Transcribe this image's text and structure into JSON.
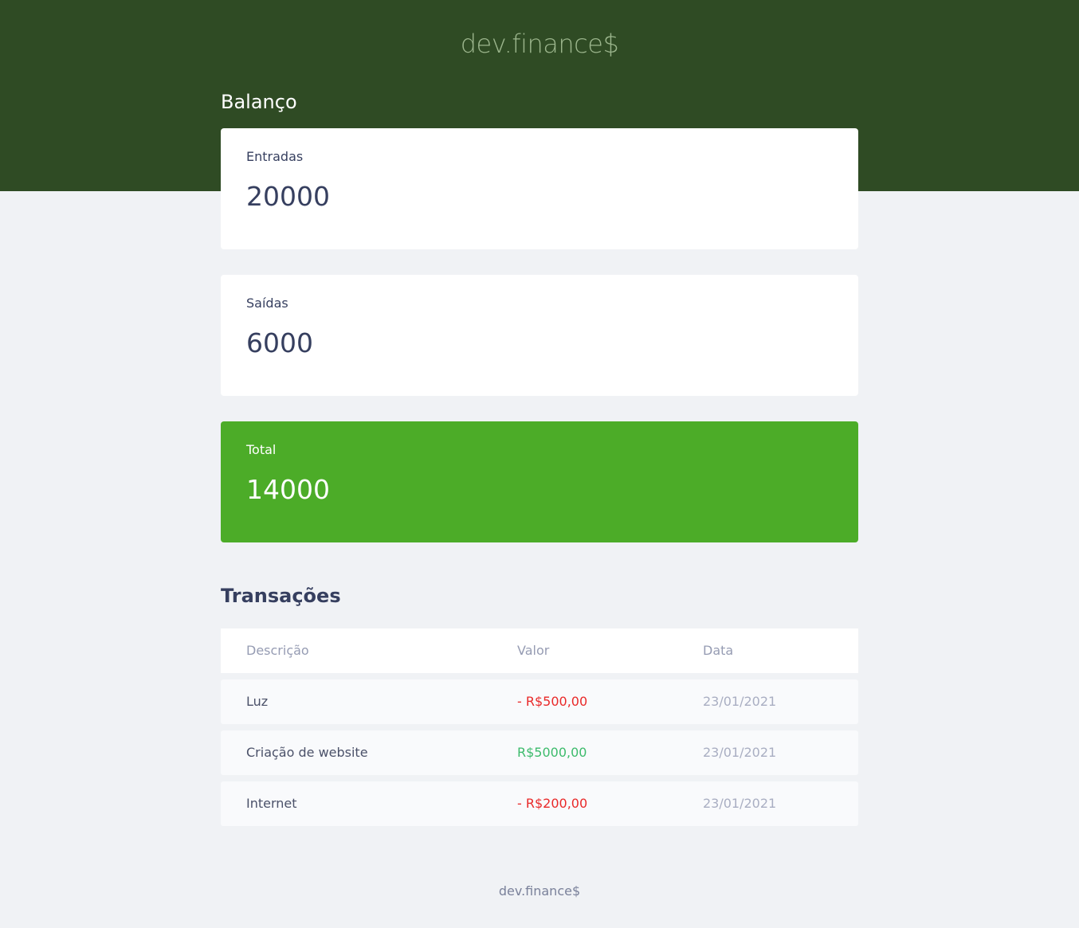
{
  "app": {
    "logo": "dev.finance$"
  },
  "balance": {
    "title": "Balanço",
    "income": {
      "label": "Entradas",
      "value": "20000"
    },
    "expense": {
      "label": "Saídas",
      "value": "6000"
    },
    "total": {
      "label": "Total",
      "value": "14000"
    }
  },
  "transactions": {
    "title": "Transações",
    "columns": [
      "Descrição",
      "Valor",
      "Data"
    ],
    "rows": [
      {
        "description": "Luz",
        "amount": "- R$500,00",
        "date": "23/01/2021",
        "type": "expense"
      },
      {
        "description": "Criação de website",
        "amount": "R$5000,00",
        "date": "23/01/2021",
        "type": "income"
      },
      {
        "description": "Internet",
        "amount": "- R$200,00",
        "date": "23/01/2021",
        "type": "expense"
      }
    ]
  },
  "footer": {
    "text": "dev.finance$"
  },
  "colors": {
    "header": "#2F4B24",
    "total_card": "#4CAC28",
    "expense": "#E92929",
    "income": "#3DBB6C",
    "background": "#F0F2F5"
  }
}
